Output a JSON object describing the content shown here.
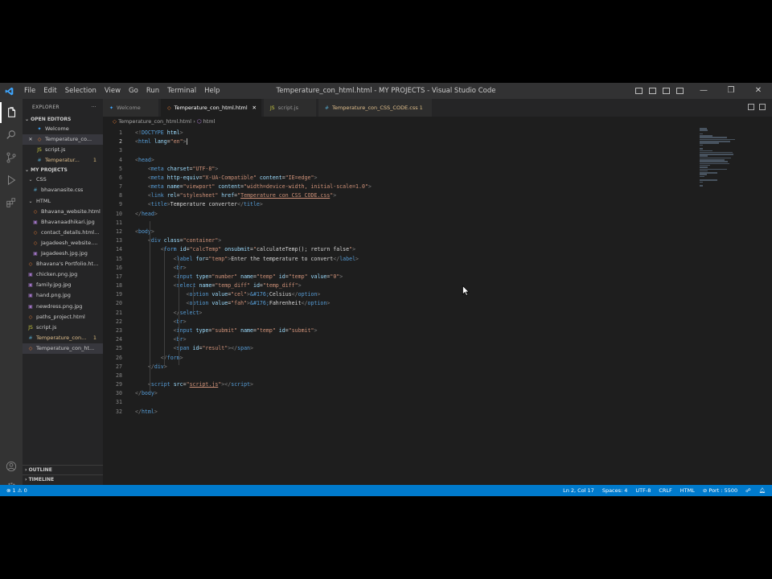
{
  "window": {
    "title": "Temperature_con_html.html - MY PROJECTS - Visual Studio Code",
    "menu": [
      "File",
      "Edit",
      "Selection",
      "View",
      "Go",
      "Run",
      "Terminal",
      "Help"
    ],
    "controls": {
      "minimize": "—",
      "restore": "❐",
      "close": "✕"
    }
  },
  "sidebar": {
    "header": "EXPLORER",
    "more": "···",
    "open_editors": {
      "label": "OPEN EDITORS",
      "items": [
        {
          "name": "Welcome",
          "icon": "vscode-icon",
          "close": ""
        },
        {
          "name": "Temperature_co...",
          "icon": "html-icon",
          "close": "✕"
        },
        {
          "name": "script.js",
          "icon": "js-icon",
          "close": ""
        },
        {
          "name": "Temperatur...",
          "icon": "css-icon",
          "close": "",
          "badge": "1"
        }
      ]
    },
    "project": {
      "label": "MY PROJECTS",
      "items": [
        {
          "name": "CSS",
          "type": "folder",
          "level": 1
        },
        {
          "name": "bhavanasite.css",
          "type": "css",
          "level": 2
        },
        {
          "name": "HTML",
          "type": "folder",
          "level": 1
        },
        {
          "name": "Bhavana_website.html",
          "type": "html",
          "level": 2
        },
        {
          "name": "Bhavanaadhikari.jpg",
          "type": "img",
          "level": 2
        },
        {
          "name": "contact_details.html...",
          "type": "html",
          "level": 2
        },
        {
          "name": "Jagadeesh_website....",
          "type": "html",
          "level": 2
        },
        {
          "name": "Jagadeesh.jpg.jpg",
          "type": "img",
          "level": 2
        },
        {
          "name": "Bhavana's Portfolio.ht...",
          "type": "html",
          "level": 1
        },
        {
          "name": "chicken.png.jpg",
          "type": "img",
          "level": 1
        },
        {
          "name": "family.jpg.jpg",
          "type": "img",
          "level": 1
        },
        {
          "name": "hand.png.jpg",
          "type": "img",
          "level": 1
        },
        {
          "name": "newdress.png.jpg",
          "type": "img",
          "level": 1
        },
        {
          "name": "paths_project.html",
          "type": "html",
          "level": 1
        },
        {
          "name": "script.js",
          "type": "js",
          "level": 1
        },
        {
          "name": "Temperature_con...",
          "type": "css",
          "level": 1,
          "badge": "1"
        },
        {
          "name": "Temperature_con_ht...",
          "type": "html",
          "level": 1
        }
      ]
    },
    "outline": "OUTLINE",
    "timeline": "TIMELINE"
  },
  "tabs": [
    {
      "label": "Welcome",
      "icon": "vscode-icon",
      "active": false,
      "close": ""
    },
    {
      "label": "Temperature_con_html.html",
      "icon": "html-icon",
      "active": true,
      "close": "✕"
    },
    {
      "label": "script.js",
      "icon": "js-icon",
      "active": false,
      "close": ""
    },
    {
      "label": "Temperature_con_CSS_CODE.css",
      "icon": "css-icon",
      "active": false,
      "close": "",
      "badge": "1"
    }
  ],
  "breadcrumb": {
    "file": "Temperature_con_html.html",
    "sep": "›",
    "node": "html"
  },
  "editor": {
    "current_line": 2,
    "lines": [
      [
        [
          "br",
          "<!"
        ],
        [
          "tag",
          "DOCTYPE"
        ],
        [
          "txt",
          " "
        ],
        [
          "attr",
          "html"
        ],
        [
          "br",
          ">"
        ]
      ],
      [
        [
          "br",
          "<"
        ],
        [
          "tag",
          "html"
        ],
        [
          "txt",
          " "
        ],
        [
          "attr",
          "lang"
        ],
        [
          "txt",
          "="
        ],
        [
          "str",
          "\"en\""
        ],
        [
          "br",
          ">"
        ],
        [
          "cursor",
          ""
        ]
      ],
      [],
      [
        [
          "br",
          "<"
        ],
        [
          "tag",
          "head"
        ],
        [
          "br",
          ">"
        ]
      ],
      [
        [
          "txt",
          "    "
        ],
        [
          "br",
          "<"
        ],
        [
          "tag",
          "meta"
        ],
        [
          "txt",
          " "
        ],
        [
          "attr",
          "charset"
        ],
        [
          "txt",
          "="
        ],
        [
          "str",
          "\"UTF-8\""
        ],
        [
          "br",
          ">"
        ]
      ],
      [
        [
          "txt",
          "    "
        ],
        [
          "br",
          "<"
        ],
        [
          "tag",
          "meta"
        ],
        [
          "txt",
          " "
        ],
        [
          "attr",
          "http-equiv"
        ],
        [
          "txt",
          "="
        ],
        [
          "str",
          "\"X-UA-Compatible\""
        ],
        [
          "txt",
          " "
        ],
        [
          "attr",
          "content"
        ],
        [
          "txt",
          "="
        ],
        [
          "str",
          "\"IE=edge\""
        ],
        [
          "br",
          ">"
        ]
      ],
      [
        [
          "txt",
          "    "
        ],
        [
          "br",
          "<"
        ],
        [
          "tag",
          "meta"
        ],
        [
          "txt",
          " "
        ],
        [
          "attr",
          "name"
        ],
        [
          "txt",
          "="
        ],
        [
          "str",
          "\"viewport\""
        ],
        [
          "txt",
          " "
        ],
        [
          "attr",
          "content"
        ],
        [
          "txt",
          "="
        ],
        [
          "str",
          "\"width=device-width, initial-scale=1.0\""
        ],
        [
          "br",
          ">"
        ]
      ],
      [
        [
          "txt",
          "    "
        ],
        [
          "br",
          "<"
        ],
        [
          "tag",
          "link"
        ],
        [
          "txt",
          " "
        ],
        [
          "attr",
          "rel"
        ],
        [
          "txt",
          "="
        ],
        [
          "str",
          "\"stylesheet\""
        ],
        [
          "txt",
          " "
        ],
        [
          "attr",
          "href"
        ],
        [
          "txt",
          "="
        ],
        [
          "str",
          "\""
        ],
        [
          "stru",
          "Temperature_con_CSS_CODE.css"
        ],
        [
          "str",
          "\""
        ],
        [
          "br",
          ">"
        ]
      ],
      [
        [
          "txt",
          "    "
        ],
        [
          "br",
          "<"
        ],
        [
          "tag",
          "title"
        ],
        [
          "br",
          ">"
        ],
        [
          "txt",
          "Temperature converter"
        ],
        [
          "br",
          "</"
        ],
        [
          "tag",
          "title"
        ],
        [
          "br",
          ">"
        ]
      ],
      [
        [
          "br",
          "</"
        ],
        [
          "tag",
          "head"
        ],
        [
          "br",
          ">"
        ]
      ],
      [],
      [
        [
          "br",
          "<"
        ],
        [
          "tag",
          "body"
        ],
        [
          "br",
          ">"
        ]
      ],
      [
        [
          "txt",
          "    "
        ],
        [
          "br",
          "<"
        ],
        [
          "tag",
          "div"
        ],
        [
          "txt",
          " "
        ],
        [
          "attr",
          "class"
        ],
        [
          "txt",
          "="
        ],
        [
          "str",
          "\"container\""
        ],
        [
          "br",
          ">"
        ]
      ],
      [
        [
          "txt",
          "        "
        ],
        [
          "br",
          "<"
        ],
        [
          "tag",
          "form"
        ],
        [
          "txt",
          " "
        ],
        [
          "attr",
          "id"
        ],
        [
          "txt",
          "="
        ],
        [
          "str",
          "\"calcTemp\""
        ],
        [
          "txt",
          " "
        ],
        [
          "attr",
          "onsubmit"
        ],
        [
          "txt",
          "="
        ],
        [
          "str",
          "\""
        ],
        [
          "txt",
          "calculateTemp(); return false"
        ],
        [
          "str",
          "\""
        ],
        [
          "br",
          ">"
        ]
      ],
      [
        [
          "txt",
          "            "
        ],
        [
          "br",
          "<"
        ],
        [
          "tag",
          "label"
        ],
        [
          "txt",
          " "
        ],
        [
          "attr",
          "for"
        ],
        [
          "txt",
          "="
        ],
        [
          "str",
          "\"temp\""
        ],
        [
          "br",
          ">"
        ],
        [
          "txt",
          "Enter the temperature to convert"
        ],
        [
          "br",
          "</"
        ],
        [
          "tag",
          "label"
        ],
        [
          "br",
          ">"
        ]
      ],
      [
        [
          "txt",
          "            "
        ],
        [
          "br",
          "<"
        ],
        [
          "tag",
          "br"
        ],
        [
          "br",
          ">"
        ]
      ],
      [
        [
          "txt",
          "            "
        ],
        [
          "br",
          "<"
        ],
        [
          "tag",
          "input"
        ],
        [
          "txt",
          " "
        ],
        [
          "attr",
          "type"
        ],
        [
          "txt",
          "="
        ],
        [
          "str",
          "\"number\""
        ],
        [
          "txt",
          " "
        ],
        [
          "attr",
          "name"
        ],
        [
          "txt",
          "="
        ],
        [
          "str",
          "\"temp\""
        ],
        [
          "txt",
          " "
        ],
        [
          "attr",
          "id"
        ],
        [
          "txt",
          "="
        ],
        [
          "str",
          "\"temp\""
        ],
        [
          "txt",
          " "
        ],
        [
          "attr",
          "value"
        ],
        [
          "txt",
          "="
        ],
        [
          "str",
          "\"0\""
        ],
        [
          "br",
          ">"
        ]
      ],
      [
        [
          "txt",
          "            "
        ],
        [
          "br",
          "<"
        ],
        [
          "tag",
          "select"
        ],
        [
          "txt",
          " "
        ],
        [
          "attr",
          "name"
        ],
        [
          "txt",
          "="
        ],
        [
          "str",
          "\"temp_diff\""
        ],
        [
          "txt",
          " "
        ],
        [
          "attr",
          "id"
        ],
        [
          "txt",
          "="
        ],
        [
          "str",
          "\"temp_diff\""
        ],
        [
          "br",
          ">"
        ]
      ],
      [
        [
          "txt",
          "                "
        ],
        [
          "br",
          "<"
        ],
        [
          "tag",
          "option"
        ],
        [
          "txt",
          " "
        ],
        [
          "attr",
          "value"
        ],
        [
          "txt",
          "="
        ],
        [
          "str",
          "\"cel\""
        ],
        [
          "br",
          ">"
        ],
        [
          "ent",
          "&#176;"
        ],
        [
          "txt",
          "Celsius"
        ],
        [
          "br",
          "</"
        ],
        [
          "tag",
          "option"
        ],
        [
          "br",
          ">"
        ]
      ],
      [
        [
          "txt",
          "                "
        ],
        [
          "br",
          "<"
        ],
        [
          "tag",
          "option"
        ],
        [
          "txt",
          " "
        ],
        [
          "attr",
          "value"
        ],
        [
          "txt",
          "="
        ],
        [
          "str",
          "\"fah\""
        ],
        [
          "br",
          ">"
        ],
        [
          "ent",
          "&#176;"
        ],
        [
          "txt",
          "Fahrenheit"
        ],
        [
          "br",
          "</"
        ],
        [
          "tag",
          "option"
        ],
        [
          "br",
          ">"
        ]
      ],
      [
        [
          "txt",
          "            "
        ],
        [
          "br",
          "</"
        ],
        [
          "tag",
          "select"
        ],
        [
          "br",
          ">"
        ]
      ],
      [
        [
          "txt",
          "            "
        ],
        [
          "br",
          "<"
        ],
        [
          "tag",
          "br"
        ],
        [
          "br",
          ">"
        ]
      ],
      [
        [
          "txt",
          "            "
        ],
        [
          "br",
          "<"
        ],
        [
          "tag",
          "input"
        ],
        [
          "txt",
          " "
        ],
        [
          "attr",
          "type"
        ],
        [
          "txt",
          "="
        ],
        [
          "str",
          "\"submit\""
        ],
        [
          "txt",
          " "
        ],
        [
          "attr",
          "name"
        ],
        [
          "txt",
          "="
        ],
        [
          "str",
          "\"temp\""
        ],
        [
          "txt",
          " "
        ],
        [
          "attr",
          "id"
        ],
        [
          "txt",
          "="
        ],
        [
          "str",
          "\"submit\""
        ],
        [
          "br",
          ">"
        ]
      ],
      [
        [
          "txt",
          "            "
        ],
        [
          "br",
          "<"
        ],
        [
          "tag",
          "br"
        ],
        [
          "br",
          ">"
        ]
      ],
      [
        [
          "txt",
          "            "
        ],
        [
          "br",
          "<"
        ],
        [
          "tag",
          "span"
        ],
        [
          "txt",
          " "
        ],
        [
          "attr",
          "id"
        ],
        [
          "txt",
          "="
        ],
        [
          "str",
          "\"result\""
        ],
        [
          "br",
          "></"
        ],
        [
          "tag",
          "span"
        ],
        [
          "br",
          ">"
        ]
      ],
      [
        [
          "txt",
          "        "
        ],
        [
          "br",
          "</"
        ],
        [
          "tag",
          "form"
        ],
        [
          "br",
          ">"
        ]
      ],
      [
        [
          "txt",
          "    "
        ],
        [
          "br",
          "</"
        ],
        [
          "tag",
          "div"
        ],
        [
          "br",
          ">"
        ]
      ],
      [],
      [
        [
          "txt",
          "    "
        ],
        [
          "br",
          "<"
        ],
        [
          "tag",
          "script"
        ],
        [
          "txt",
          " "
        ],
        [
          "attr",
          "src"
        ],
        [
          "txt",
          "="
        ],
        [
          "str",
          "\""
        ],
        [
          "stru",
          "script.js"
        ],
        [
          "str",
          "\""
        ],
        [
          "br",
          "></"
        ],
        [
          "tag",
          "script"
        ],
        [
          "br",
          ">"
        ]
      ],
      [
        [
          "br",
          "</"
        ],
        [
          "tag",
          "body"
        ],
        [
          "br",
          ">"
        ]
      ],
      [],
      [
        [
          "br",
          "</"
        ],
        [
          "tag",
          "html"
        ],
        [
          "br",
          ">"
        ]
      ]
    ]
  },
  "status": {
    "errors": "⊗ 1",
    "warnings": "⚠ 0",
    "position": "Ln 2, Col 17",
    "spaces": "Spaces: 4",
    "encoding": "UTF-8",
    "eol": "CRLF",
    "language": "HTML",
    "port": "⊘ Port : 5500"
  },
  "colors": {
    "accent": "#007acc",
    "editor_bg": "#1e1e1e",
    "sidebar_bg": "#252526"
  }
}
